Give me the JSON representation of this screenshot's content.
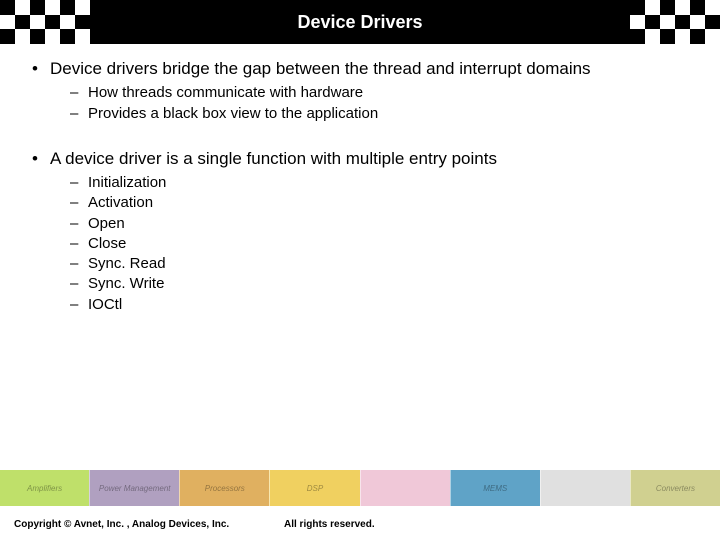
{
  "header": {
    "title": "Device Drivers"
  },
  "bullets": [
    {
      "text": "Device drivers bridge the gap between the thread and interrupt domains",
      "sub": [
        "How  threads communicate with hardware",
        "Provides a black box view to the application"
      ]
    },
    {
      "text": "A device driver is a single function with multiple entry points",
      "sub": [
        "Initialization",
        "Activation",
        "Open",
        "Close",
        "Sync. Read",
        "Sync. Write",
        "IOCtl"
      ]
    }
  ],
  "footer_segments": [
    {
      "label": "Amplifiers",
      "color": "#bfe06a"
    },
    {
      "label": "Power Management",
      "color": "#b0a0c0"
    },
    {
      "label": "Processors",
      "color": "#e0b060"
    },
    {
      "label": "DSP",
      "color": "#f0d060"
    },
    {
      "label": "",
      "color": "#f0c8d8"
    },
    {
      "label": "MEMS",
      "color": "#5fa3c7"
    },
    {
      "label": "",
      "color": "#e0e0e0"
    },
    {
      "label": "Converters",
      "color": "#d0d090"
    }
  ],
  "footer": {
    "copyright": "Copyright © Avnet, Inc. , Analog Devices, Inc.",
    "rights": "All rights reserved."
  }
}
